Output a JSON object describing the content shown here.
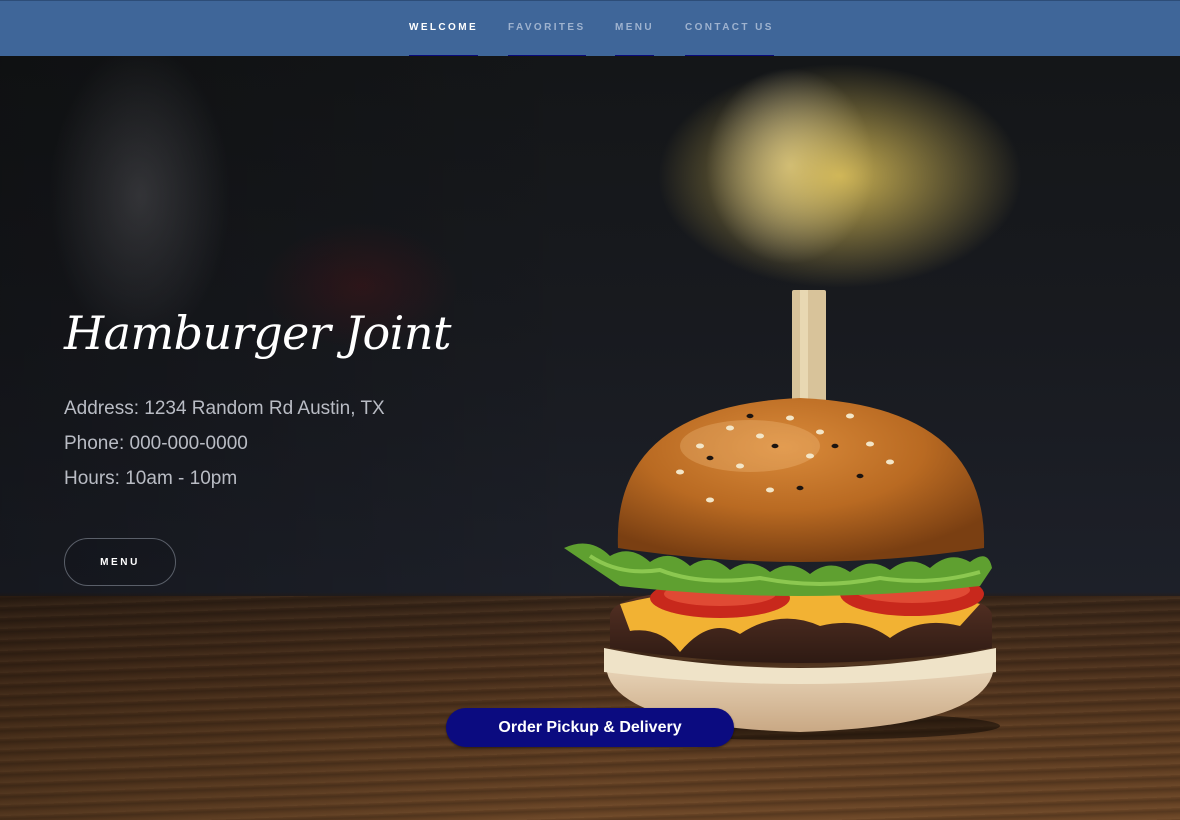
{
  "nav": {
    "items": [
      {
        "label": "WELCOME",
        "active": true
      },
      {
        "label": "FAVORITES",
        "active": false
      },
      {
        "label": "MENU",
        "active": false
      },
      {
        "label": "CONTACT US",
        "active": false
      }
    ]
  },
  "hero": {
    "title": "Hamburger Joint",
    "address": "Address: 1234 Random Rd Austin, TX",
    "phone": "Phone: 000-000-0000",
    "hours": "Hours: 10am - 10pm",
    "menu_button": "MENU",
    "image": "hamburger-photo"
  },
  "order_button": "Order Pickup & Delivery",
  "colors": {
    "nav_bg": "#3f6699",
    "nav_active": "#ffffff",
    "nav_inactive": "#9fb3cf",
    "nav_underline": "#0a0a7a",
    "order_button_bg": "#0b0b80"
  }
}
